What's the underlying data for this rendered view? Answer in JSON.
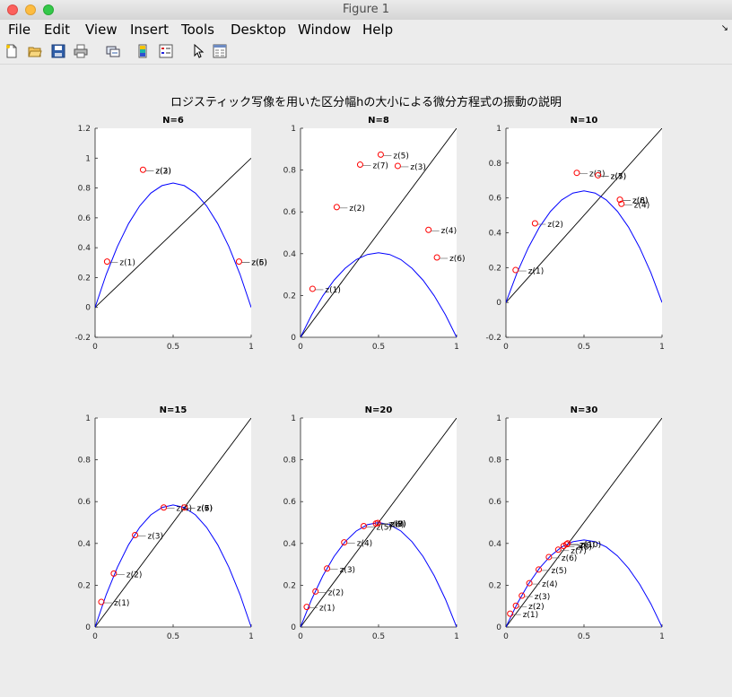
{
  "window": {
    "title": "Figure 1"
  },
  "menu": [
    "File",
    "Edit",
    "View",
    "Insert",
    "Tools",
    "Desktop",
    "Window",
    "Help"
  ],
  "menu_arrow": "↘",
  "toolbar_icons": [
    "new-figure-icon",
    "open-file-icon",
    "save-icon",
    "print-icon",
    "link-icon",
    "colorbar-icon",
    "legend-icon",
    "pointer-icon",
    "property-editor-icon"
  ],
  "colors": {
    "map_curve": "#0000ff",
    "diagonal": "#000000",
    "marker": "#ff0000",
    "axes_bg": "#ffffff",
    "figure_bg": "#ececec"
  },
  "chart_data": {
    "suptitle": "ロジスティック写像を用いた区分幅hの大小による微分方程式の振動の説明",
    "plots": [
      {
        "title": "N=6",
        "type": "line",
        "xlim": [
          0,
          1
        ],
        "ylim": [
          -0.2,
          1.2
        ],
        "xticks": [
          "0",
          "0.5",
          "1"
        ],
        "yticks": [
          "-0.2",
          "0",
          "0.2",
          "0.4",
          "0.6",
          "0.8",
          "1",
          "1.2"
        ],
        "points": [
          {
            "x": 0.077,
            "y": 0.307,
            "label": "z(1)"
          },
          {
            "x": 0.307,
            "y": 0.922,
            "label": "z(3)"
          },
          {
            "x": 0.922,
            "y": 0.307,
            "label": "z(5)"
          }
        ],
        "overlap_labels": [
          {
            "x": 0.307,
            "y": 0.922,
            "label": "z(2)"
          },
          {
            "x": 0.922,
            "y": 0.307,
            "label": "z(6)"
          }
        ]
      },
      {
        "title": "N=8",
        "type": "line",
        "xlim": [
          0,
          1
        ],
        "ylim": [
          0,
          1
        ],
        "xticks": [
          "0",
          "0.5",
          "1"
        ],
        "yticks": [
          "0",
          "0.2",
          "0.4",
          "0.6",
          "0.8",
          "1"
        ],
        "points": [
          {
            "x": 0.077,
            "y": 0.232,
            "label": "z(1)"
          },
          {
            "x": 0.232,
            "y": 0.623,
            "label": "z(2)"
          },
          {
            "x": 0.623,
            "y": 0.82,
            "label": "z(3)"
          },
          {
            "x": 0.82,
            "y": 0.514,
            "label": "z(4)"
          },
          {
            "x": 0.514,
            "y": 0.874,
            "label": "z(5)"
          },
          {
            "x": 0.874,
            "y": 0.382,
            "label": "z(6)"
          },
          {
            "x": 0.382,
            "y": 0.826,
            "label": "z(7)"
          }
        ]
      },
      {
        "title": "N=10",
        "type": "line",
        "xlim": [
          0,
          1
        ],
        "ylim": [
          -0.2,
          1
        ],
        "xticks": [
          "0",
          "0.5",
          "1"
        ],
        "yticks": [
          "-0.2",
          "0",
          "0.2",
          "0.4",
          "0.6",
          "0.8",
          "1"
        ],
        "points": [
          {
            "x": 0.062,
            "y": 0.186,
            "label": "z(1)"
          },
          {
            "x": 0.186,
            "y": 0.454,
            "label": "z(2)"
          },
          {
            "x": 0.454,
            "y": 0.744,
            "label": "z(3)"
          },
          {
            "x": 0.59,
            "y": 0.73,
            "label": "z(5)"
          },
          {
            "x": 0.73,
            "y": 0.59,
            "label": "z(6)"
          },
          {
            "x": 0.74,
            "y": 0.566,
            "label": "z(4)"
          }
        ],
        "overlap_labels": [
          {
            "x": 0.59,
            "y": 0.73,
            "label": "z(7)"
          },
          {
            "x": 0.73,
            "y": 0.59,
            "label": "z(8)"
          }
        ]
      },
      {
        "title": "N=15",
        "type": "line",
        "xlim": [
          0,
          1
        ],
        "ylim": [
          0,
          1
        ],
        "xticks": [
          "0",
          "0.5",
          "1"
        ],
        "yticks": [
          "0",
          "0.2",
          "0.4",
          "0.6",
          "0.8",
          "1"
        ],
        "points": [
          {
            "x": 0.04,
            "y": 0.12,
            "label": "z(1)"
          },
          {
            "x": 0.12,
            "y": 0.256,
            "label": "z(2)"
          },
          {
            "x": 0.256,
            "y": 0.44,
            "label": "z(3)"
          },
          {
            "x": 0.44,
            "y": 0.572,
            "label": "z(4)"
          },
          {
            "x": 0.572,
            "y": 0.572,
            "label": "z(5)"
          }
        ],
        "overlap_labels": [
          {
            "x": 0.572,
            "y": 0.572,
            "label": "z(6)"
          },
          {
            "x": 0.572,
            "y": 0.572,
            "label": "z(7)"
          }
        ]
      },
      {
        "title": "N=20",
        "type": "line",
        "xlim": [
          0,
          1
        ],
        "ylim": [
          0,
          1
        ],
        "xticks": [
          "0",
          "0.5",
          "1"
        ],
        "yticks": [
          "0",
          "0.2",
          "0.4",
          "0.6",
          "0.8",
          "1"
        ],
        "points": [
          {
            "x": 0.04,
            "y": 0.096,
            "label": "z(1)"
          },
          {
            "x": 0.096,
            "y": 0.17,
            "label": "z(2)"
          },
          {
            "x": 0.17,
            "y": 0.28,
            "label": "z(3)"
          },
          {
            "x": 0.28,
            "y": 0.405,
            "label": "z(4)"
          },
          {
            "x": 0.405,
            "y": 0.483,
            "label": "z(5)"
          },
          {
            "x": 0.483,
            "y": 0.495,
            "label": "z(6)"
          },
          {
            "x": 0.495,
            "y": 0.498,
            "label": "z(7)"
          }
        ],
        "overlap_labels": [
          {
            "x": 0.495,
            "y": 0.498,
            "label": "z(8)"
          },
          {
            "x": 0.495,
            "y": 0.498,
            "label": "z(9)"
          }
        ]
      },
      {
        "title": "N=30",
        "type": "line",
        "xlim": [
          0,
          1
        ],
        "ylim": [
          0,
          1
        ],
        "xticks": [
          "0",
          "0.5",
          "1"
        ],
        "yticks": [
          "0",
          "0.2",
          "0.4",
          "0.6",
          "0.8",
          "1"
        ],
        "points": [
          {
            "x": 0.027,
            "y": 0.064,
            "label": "z(1)"
          },
          {
            "x": 0.064,
            "y": 0.102,
            "label": "z(2)"
          },
          {
            "x": 0.102,
            "y": 0.15,
            "label": "z(3)"
          },
          {
            "x": 0.15,
            "y": 0.21,
            "label": "z(4)"
          },
          {
            "x": 0.21,
            "y": 0.275,
            "label": "z(5)"
          },
          {
            "x": 0.275,
            "y": 0.335,
            "label": "z(6)"
          },
          {
            "x": 0.335,
            "y": 0.37,
            "label": "z(7)"
          },
          {
            "x": 0.37,
            "y": 0.388,
            "label": "z(8)"
          },
          {
            "x": 0.388,
            "y": 0.396,
            "label": "z(9)"
          },
          {
            "x": 0.396,
            "y": 0.4,
            "label": "z(10)"
          }
        ]
      }
    ]
  }
}
